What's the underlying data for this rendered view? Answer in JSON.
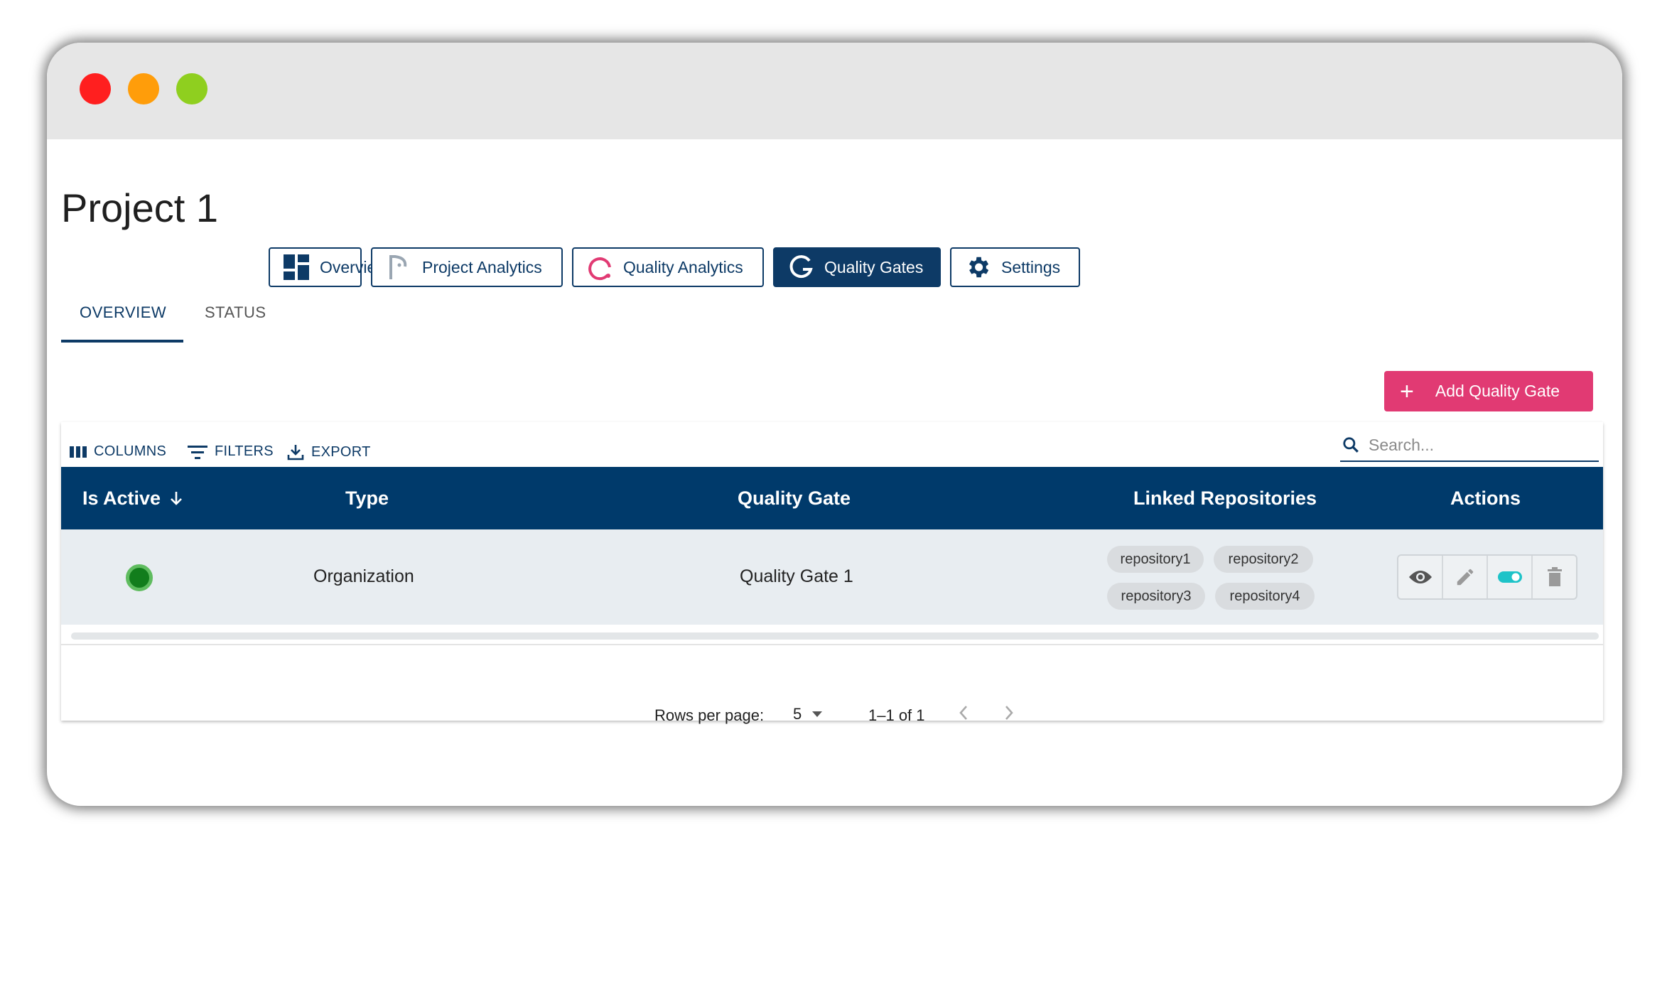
{
  "page": {
    "title": "Project 1"
  },
  "nav": [
    {
      "label": "Overview",
      "icon": "dashboard-icon"
    },
    {
      "label": "Project Analytics",
      "icon": "project-analytics-icon"
    },
    {
      "label": "Quality Analytics",
      "icon": "quality-analytics-icon"
    },
    {
      "label": "Quality Gates",
      "icon": "quality-gates-icon",
      "active": true
    },
    {
      "label": "Settings",
      "icon": "gear-icon"
    }
  ],
  "subtabs": [
    {
      "label": "OVERVIEW",
      "selected": true
    },
    {
      "label": "STATUS",
      "selected": false
    }
  ],
  "add_button": {
    "label": "Add Quality Gate"
  },
  "toolbar": {
    "columns": "COLUMNS",
    "filters": "FILTERS",
    "export": "EXPORT"
  },
  "search": {
    "placeholder": "Search..."
  },
  "table": {
    "headers": [
      "Is Active",
      "Type",
      "Quality Gate",
      "Linked Repositories",
      "Actions"
    ],
    "rows": [
      {
        "active": true,
        "type": "Organization",
        "quality_gate": "Quality Gate 1",
        "repositories": [
          "repository1",
          "repository2",
          "repository3",
          "repository4"
        ]
      }
    ]
  },
  "pagination": {
    "rows_label": "Rows per page:",
    "rows_value": "5",
    "range": "1–1 of 1"
  },
  "colors": {
    "primary": "#003a6b",
    "accent": "#e13a73",
    "active_dot": "#127d1c",
    "toggle": "#1ec3c8"
  }
}
